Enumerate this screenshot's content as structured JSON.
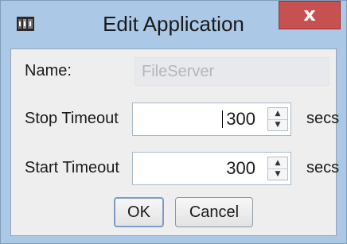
{
  "window": {
    "title": "Edit Application",
    "close_label": "x"
  },
  "form": {
    "name_label": "Name:",
    "name_value": "FileServer",
    "stop_label": "Stop Timeout",
    "stop_value": "300",
    "start_label": "Start Timeout",
    "start_value": "300",
    "units": "secs"
  },
  "buttons": {
    "ok": "OK",
    "cancel": "Cancel"
  }
}
